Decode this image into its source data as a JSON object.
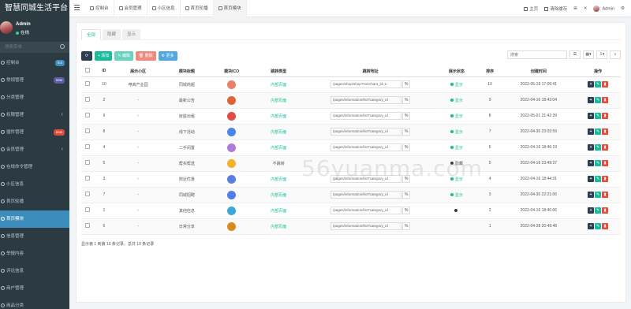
{
  "app": {
    "title": "智慧同城生活平台"
  },
  "user": {
    "name": "Admin",
    "status": "在线"
  },
  "sidebar": {
    "search_placeholder": "搜索菜单",
    "items": [
      {
        "label": "控制台",
        "badge": "hot",
        "badge_color": "#3c8dbc"
      },
      {
        "label": "常规管理",
        "badge": "new",
        "badge_color": "#605ca8"
      },
      {
        "label": "分类管理"
      },
      {
        "label": "权限管理",
        "caret": "‹"
      },
      {
        "label": "插件管理",
        "badge": "new",
        "badge_color": "#dd4b39"
      },
      {
        "label": "会员管理",
        "caret": "‹"
      },
      {
        "label": "在线命令管理"
      },
      {
        "label": "小区信息"
      },
      {
        "label": "首页轮播"
      },
      {
        "label": "首页模块",
        "active": true
      },
      {
        "label": "信息管理"
      },
      {
        "label": "举报内容"
      },
      {
        "label": "评论信息"
      },
      {
        "label": "商户管理"
      },
      {
        "label": "商品分类"
      }
    ]
  },
  "nav": {
    "tabs": [
      {
        "label": "控制台",
        "active": false
      },
      {
        "label": "会员管理",
        "active": false
      },
      {
        "label": "小区信息",
        "active": false
      },
      {
        "label": "首页轮播",
        "active": false
      },
      {
        "label": "首页模块",
        "active": true
      }
    ],
    "home": "主页",
    "clear_cache": "清除缓存",
    "admin": "Admin"
  },
  "subtabs": [
    "全部",
    "隐藏",
    "显示"
  ],
  "toolbar": {
    "add": "+ 添加",
    "edit": "✎ 编辑",
    "delete": "🗑 删除",
    "more": "⚙ 更多"
  },
  "search": {
    "placeholder": "搜索"
  },
  "table": {
    "headers": [
      "ID",
      "展示小区",
      "模块标题",
      "模块ICO",
      "跳转类型",
      "跳转地址",
      "展示状态",
      "排序",
      "创建时间",
      "操作"
    ],
    "rows": [
      {
        "id": "10",
        "community": "电商产业园",
        "title": "同城商超",
        "icon_color": "#e8806a",
        "jump_type": "内部页面",
        "url": "/pages/shop/shop?merchant_id=1",
        "status": "显示",
        "status_color": "#18bc9c",
        "sort": "10",
        "created": "2022-05-19 17:06:41"
      },
      {
        "id": "2",
        "community": "-",
        "title": "最新公告",
        "icon_color": "#e2613b",
        "jump_type": "内部页面",
        "url": "/pages/information/list?category_id",
        "status": "显示",
        "status_color": "#18bc9c",
        "sort": "9",
        "created": "2022-04-16 18:43:04"
      },
      {
        "id": "9",
        "community": "-",
        "title": "房屋出租",
        "icon_color": "#e44a45",
        "jump_type": "内部页面",
        "url": "/pages/information/list?category_id",
        "status": "显示",
        "status_color": "#18bc9c",
        "sort": "8",
        "created": "2022-05-01 21:42:39"
      },
      {
        "id": "8",
        "community": "-",
        "title": "线下活动",
        "icon_color": "#4a86e8",
        "jump_type": "内部页面",
        "url": "/pages/information/list?category_id",
        "status": "显示",
        "status_color": "#18bc9c",
        "sort": "7",
        "created": "2022-04-30 23:02:59"
      },
      {
        "id": "4",
        "community": "-",
        "title": "二手闲置",
        "icon_color": "#b27ad8",
        "jump_type": "内部页面",
        "url": "/pages/information/list?category_id",
        "status": "显示",
        "status_color": "#18bc9c",
        "sort": "6",
        "created": "2022-04-16 18:46:19"
      },
      {
        "id": "5",
        "community": "-",
        "title": "帮买帮送",
        "icon_color": "#f1b32a",
        "jump_type": "不跳转",
        "url": "",
        "status": "隐藏",
        "status_color": "#2c3e50",
        "sort": "5",
        "created": "2022-04-16 23:49:37"
      },
      {
        "id": "3",
        "community": "-",
        "title": "附近优惠",
        "icon_color": "#5b7fe0",
        "jump_type": "内部页面",
        "url": "/pages/information/list?category_id",
        "status": "显示",
        "status_color": "#18bc9c",
        "sort": "4",
        "created": "2022-04-16 18:44:31"
      },
      {
        "id": "7",
        "community": "-",
        "title": "同城招聘",
        "icon_color": "#4f7ee6",
        "jump_type": "内部页面",
        "url": "/pages/information/list?category_id",
        "status": "显示",
        "status_color": "#18bc9c",
        "sort": "3",
        "created": "2022-04-30 22:21:06"
      },
      {
        "id": "1",
        "community": "-",
        "title": "其他信息",
        "icon_color": "#3aa7d8",
        "jump_type": "内部页面",
        "url": "/pages/information/list?category_id",
        "status": "",
        "status_color": "#2c3e50",
        "sort": "2",
        "created": "2022-04-16 18:40:06"
      },
      {
        "id": "6",
        "community": "-",
        "title": "日常分享",
        "icon_color": "#d98a1c",
        "jump_type": "内部页面",
        "url": "/pages/information/list?category_id",
        "status": "",
        "status_color": "",
        "sort": "1",
        "created": "2022-04-28 20:49:48"
      }
    ]
  },
  "footer": {
    "info": "显示第 1 到第 10 条记录，总共 10 条记录"
  },
  "watermark": "56yuanma.com"
}
